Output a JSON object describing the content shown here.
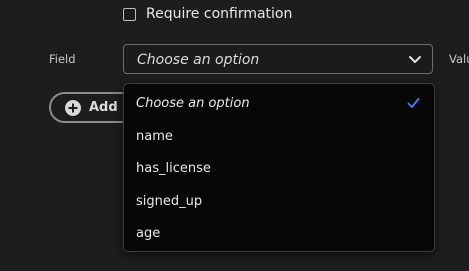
{
  "checkbox": {
    "label": "Require confirmation",
    "checked": false
  },
  "field": {
    "label": "Field",
    "selected_value": "Choose an option",
    "chevron_icon": "chevron-down-icon"
  },
  "value_field": {
    "label": "Valu"
  },
  "add_button": {
    "label": "Add F",
    "icon": "plus-circle-icon"
  },
  "dropdown": {
    "options": [
      {
        "label": "Choose an option",
        "selected": true
      },
      {
        "label": "name",
        "selected": false
      },
      {
        "label": "has_license",
        "selected": false
      },
      {
        "label": "signed_up",
        "selected": false
      },
      {
        "label": "age",
        "selected": false
      }
    ],
    "check_icon": "checkmark-icon"
  },
  "colors": {
    "background": "#1d1d1d",
    "dropdown_background": "#070707",
    "check_accent": "#4d7ff2"
  }
}
